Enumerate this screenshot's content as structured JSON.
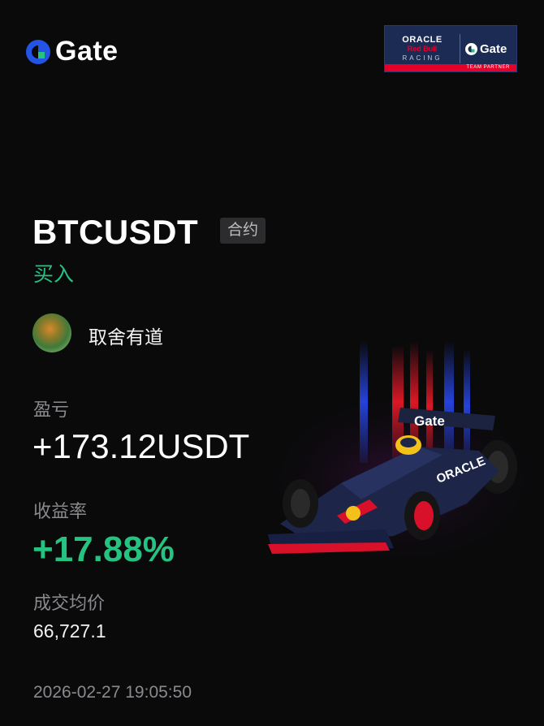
{
  "brand": {
    "name": "Gate",
    "icon": "gate-logo-icon"
  },
  "partner_badge": {
    "oracle": "ORACLE",
    "redbull": "Red Bull",
    "racing": "RACING",
    "gate": "Gate",
    "subtitle": "TEAM PARTNER"
  },
  "trade": {
    "pair": "BTCUSDT",
    "type_tag": "合约",
    "side": "买入"
  },
  "user": {
    "name": "取舍有道",
    "avatar": "user-avatar"
  },
  "stats": {
    "pnl_label": "盈亏",
    "pnl_value": "+173.12USDT",
    "rate_label": "收益率",
    "rate_value": "+17.88%",
    "avg_label": "成交均价",
    "avg_value": "66,727.1"
  },
  "timestamp": "2026-02-27 19:05:50",
  "colors": {
    "accent_green": "#26c281",
    "background": "#0a0a0b",
    "brand_blue": "#2354e6"
  }
}
